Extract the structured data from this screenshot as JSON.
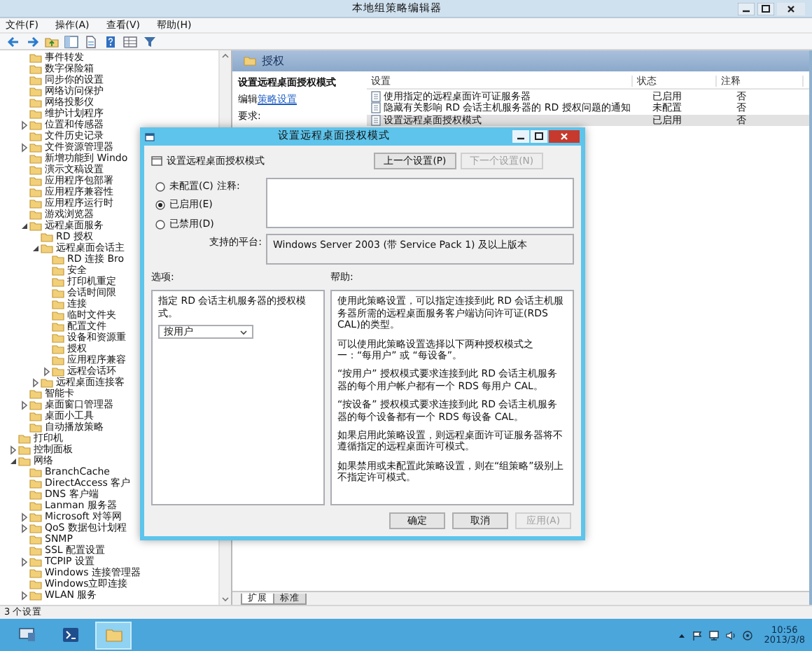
{
  "window": {
    "title": "本地组策略编辑器"
  },
  "menu": [
    {
      "label": "文件(F)"
    },
    {
      "label": "操作(A)"
    },
    {
      "label": "查看(V)"
    },
    {
      "label": "帮助(H)"
    }
  ],
  "toolbar": [
    {
      "kind": "back"
    },
    {
      "kind": "forward"
    },
    {
      "kind": "up"
    },
    {
      "kind": "tree"
    },
    {
      "kind": "export"
    },
    {
      "kind": "help"
    },
    {
      "kind": "view"
    },
    {
      "kind": "filter"
    }
  ],
  "tree": [
    {
      "children": [
        {
          "label": "事件转发"
        },
        {
          "label": "数字保险箱"
        },
        {
          "label": "同步你的设置"
        },
        {
          "label": "网络访问保护"
        },
        {
          "label": "网络投影仪"
        },
        {
          "label": "维护计划程序"
        },
        {
          "label": "位置和传感器",
          "expanded": false
        },
        {
          "label": "文件历史记录"
        },
        {
          "label": "文件资源管理器",
          "expanded": false
        },
        {
          "label": "新增功能到 Windo"
        },
        {
          "label": "演示文稿设置"
        },
        {
          "label": "应用程序包部署"
        },
        {
          "label": "应用程序兼容性"
        },
        {
          "label": "应用程序运行时"
        },
        {
          "label": "游戏浏览器"
        },
        {
          "label": "远程桌面服务",
          "expanded": true,
          "children": [
            {
              "label": "RD 授权"
            },
            {
              "label": "远程桌面会话主",
              "expanded": true,
              "children": [
                {
                  "label": "RD 连接 Bro"
                },
                {
                  "label": "安全"
                },
                {
                  "label": "打印机重定"
                },
                {
                  "label": "会话时间限"
                },
                {
                  "label": "连接"
                },
                {
                  "label": "临时文件夹"
                },
                {
                  "label": "配置文件"
                },
                {
                  "label": "设备和资源重"
                },
                {
                  "label": "授权"
                },
                {
                  "label": "应用程序兼容"
                },
                {
                  "label": "远程会话环",
                  "expanded": false
                }
              ]
            },
            {
              "label": "远程桌面连接客",
              "expanded": false
            }
          ]
        },
        {
          "label": "智能卡"
        },
        {
          "label": "桌面窗口管理器",
          "expanded": false
        },
        {
          "label": "桌面小工具"
        },
        {
          "label": "自动播放策略"
        }
      ]
    },
    {
      "label": "打印机"
    },
    {
      "label": "控制面板",
      "expanded": false
    },
    {
      "label": "网络",
      "expanded": true,
      "children": [
        {
          "label": "BranchCache"
        },
        {
          "label": "DirectAccess 客户"
        },
        {
          "label": "DNS 客户端"
        },
        {
          "label": "Lanman 服务器"
        },
        {
          "label": "Microsoft 对等网",
          "expanded": false
        },
        {
          "label": "QoS 数据包计划程",
          "expanded": false
        },
        {
          "label": "SNMP"
        },
        {
          "label": "SSL 配置设置"
        },
        {
          "label": "TCPIP 设置",
          "expanded": false
        },
        {
          "label": "Windows 连接管理器"
        },
        {
          "label": "Windows立即连接"
        },
        {
          "label": "WLAN 服务",
          "expanded": false
        }
      ]
    }
  ],
  "details": {
    "title": "授权",
    "heading": "设置远程桌面授权模式",
    "edit_prefix": "编辑",
    "edit_link": "策略设置",
    "requirements_label": "要求:",
    "columns": [
      "设置",
      "状态",
      "注释"
    ],
    "rows": [
      {
        "setting": "使用指定的远程桌面许可证服务器",
        "state": "已启用",
        "comment": "否",
        "selected": false
      },
      {
        "setting": "隐藏有关影响 RD 会话主机服务器的 RD 授权问题的通知",
        "state": "未配置",
        "comment": "否",
        "selected": false
      },
      {
        "setting": "设置远程桌面授权模式",
        "state": "已启用",
        "comment": "否",
        "selected": true
      }
    ],
    "tabs": [
      {
        "label": "扩展",
        "selected": true
      },
      {
        "label": "标准",
        "selected": false
      }
    ]
  },
  "status_bar": "3 个设置",
  "dialog": {
    "title": "设置远程桌面授权模式",
    "policy_name": "设置远程桌面授权模式",
    "nav_buttons": [
      {
        "label": "上一个设置(P)",
        "disabled": false
      },
      {
        "label": "下一个设置(N)",
        "disabled": true
      }
    ],
    "states": [
      {
        "label": "未配置(C)",
        "selected": false
      },
      {
        "label": "已启用(E)",
        "selected": true
      },
      {
        "label": "已禁用(D)",
        "selected": false
      }
    ],
    "comment_label": "注释:",
    "platform_label": "支持的平台:",
    "platform": "Windows Server 2003 (带 Service Pack 1) 及以上版本",
    "options_label": "选项:",
    "help_label": "帮助:",
    "option_text": "指定 RD 会话主机服务器的授权模式。",
    "license_mode": "按用户",
    "help": [
      "使用此策略设置，可以指定连接到此 RD 会话主机服务器所需的远程桌面服务客户端访问许可证(RDS CAL)的类型。",
      "可以使用此策略设置选择以下两种授权模式之一：“每用户” 或 “每设备”。",
      "“按用户” 授权模式要求连接到此 RD 会话主机服务器的每个用户帐户都有一个 RDS 每用户 CAL。",
      "“按设备” 授权模式要求连接到此 RD 会话主机服务器的每个设备都有一个 RDS 每设备 CAL。",
      "如果启用此策略设置，则远程桌面许可证服务器将不遵循指定的远程桌面许可模式。",
      "如果禁用或未配置此策略设置，则在“组策略”级别上不指定许可模式。"
    ],
    "buttons": [
      {
        "label": "确定",
        "disabled": false
      },
      {
        "label": "取消",
        "disabled": false
      },
      {
        "label": "应用(A)",
        "disabled": true
      }
    ]
  },
  "taskbar": {
    "apps": [
      {
        "kind": "server",
        "active": false
      },
      {
        "kind": "shell",
        "active": false
      },
      {
        "kind": "explorer",
        "active": true
      }
    ],
    "time": "10:56",
    "date": "2013/3/8"
  }
}
